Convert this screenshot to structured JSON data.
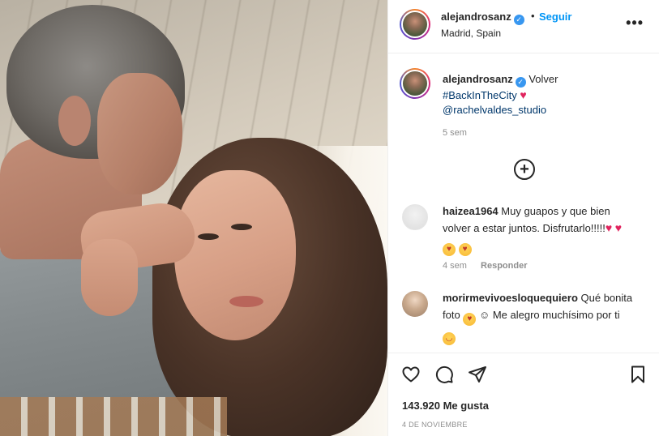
{
  "post": {
    "author": {
      "username": "alejandrosanz",
      "verified": true,
      "location": "Madrid, Spain",
      "follow_label": "Seguir",
      "separator": "•"
    },
    "more_options_icon": "more-horizontal-icon",
    "caption": {
      "username": "alejandrosanz",
      "text": "Volver",
      "hashtag": "#BackInTheCity",
      "heart": "♥",
      "mention": "@rachelvaldes_studio",
      "time": "5 sem"
    },
    "load_more_icon": "plus-circle-icon",
    "comments": [
      {
        "username": "haizea1964",
        "text_line1": "Muy guapos y que bien",
        "text_line2": "volver a estar juntos. Disfrutarlo!!!!!",
        "hearts": [
          "♥",
          "♥"
        ],
        "emojis": [
          "😘",
          "😘"
        ],
        "time": "4 sem",
        "reply_label": "Responder"
      },
      {
        "username": "morirmevivoesloquequiero",
        "text_part1": "Qué bonita",
        "text_part2": "foto",
        "emoji1": "😍",
        "emoji2": "☺",
        "text_part3": "Me alegro muchísimo por ti",
        "emoji3": "😊"
      }
    ],
    "actions": {
      "like_icon": "heart-outline-icon",
      "comment_icon": "comment-icon",
      "share_icon": "send-icon",
      "save_icon": "bookmark-icon"
    },
    "likes": "143.920 Me gusta",
    "date": "4 DE NOVIEMBRE"
  },
  "colors": {
    "accent_link": "#0095f6",
    "mention_link": "#00376b",
    "verified_badge": "#3897f0",
    "heart_red": "#e0245e",
    "secondary_text": "#8e8e8e"
  }
}
